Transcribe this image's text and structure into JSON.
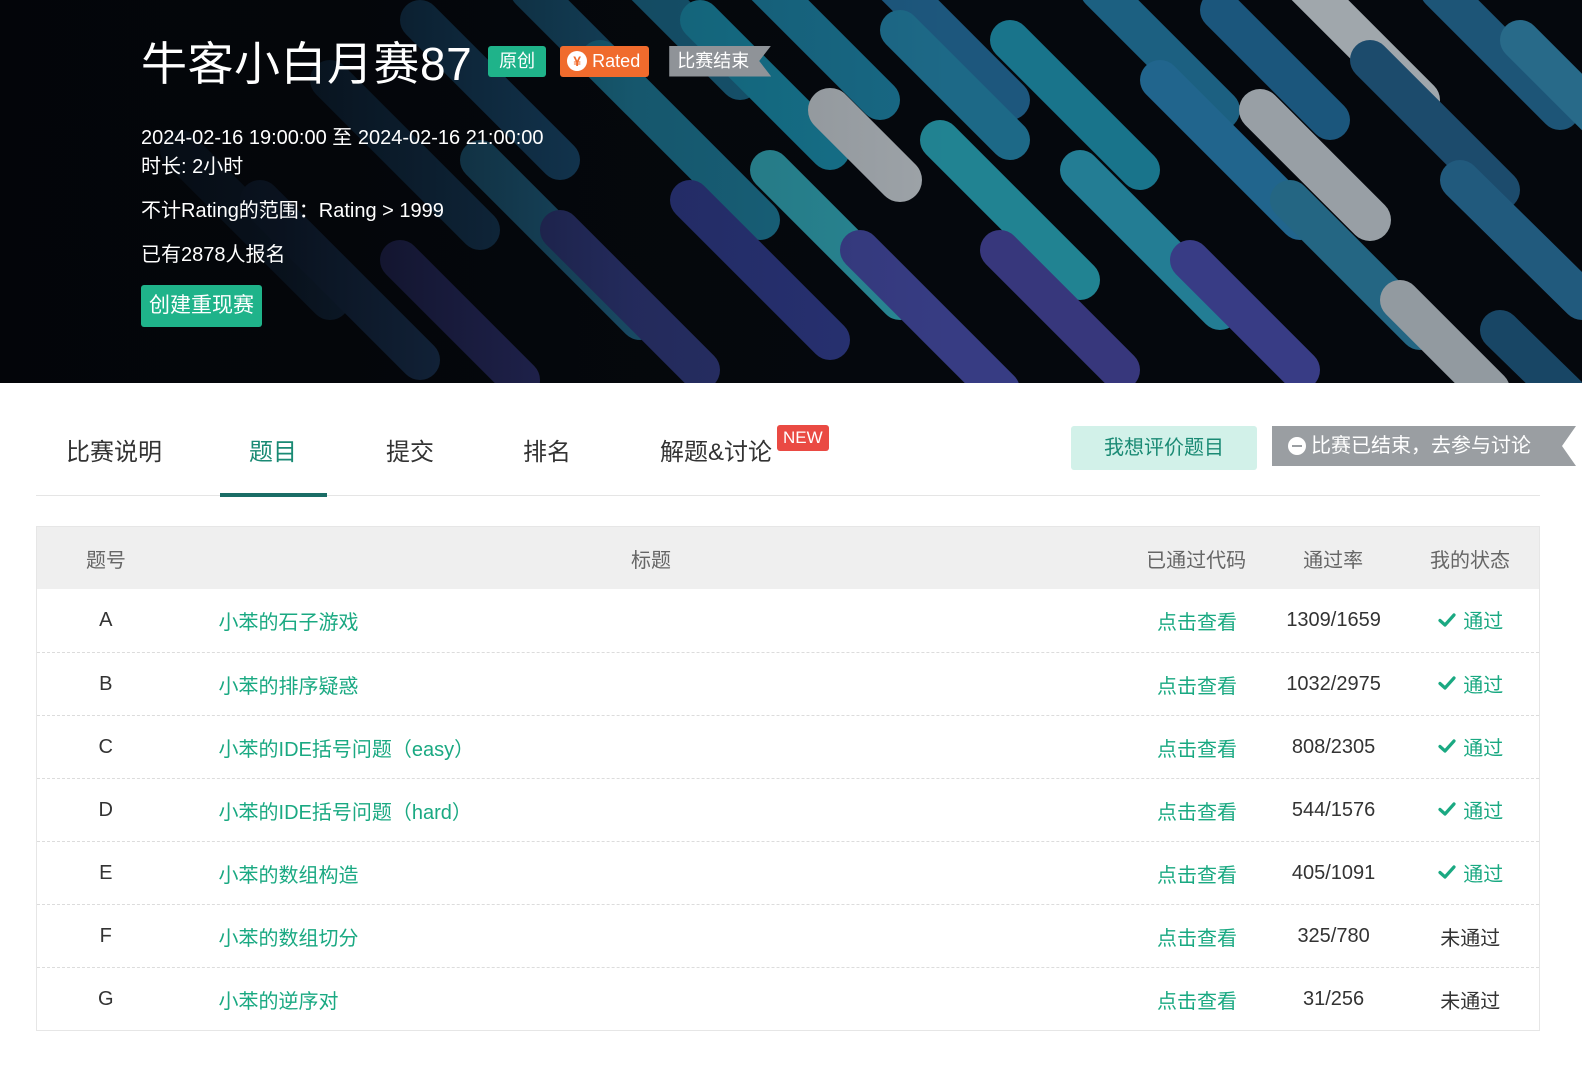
{
  "contest": {
    "title": "牛客小白月赛87",
    "tag_original": "原创",
    "tag_rated": "Rated",
    "tag_rated_icon": "yen-icon",
    "tag_ended": "比赛结束",
    "time_range": "2024-02-16 19:00:00 至 2024-02-16 21:00:00",
    "duration": "时长: 2小时",
    "rating_scope": "不计Rating的范围：Rating > 1999",
    "registered": "已有2878人报名",
    "create_replay_label": "创建重现赛"
  },
  "tabs": [
    {
      "label": "比赛说明",
      "active": false
    },
    {
      "label": "题目",
      "active": true
    },
    {
      "label": "提交",
      "active": false
    },
    {
      "label": "排名",
      "active": false
    },
    {
      "label": "解题&讨论",
      "active": false,
      "badge": "NEW"
    }
  ],
  "actions": {
    "review_label": "我想评价题目",
    "discuss_label": "比赛已结束，去参与讨论"
  },
  "table": {
    "headers": {
      "id": "题号",
      "title": "标题",
      "code": "已通过代码",
      "rate": "通过率",
      "status": "我的状态"
    },
    "rows": [
      {
        "id": "A",
        "title": "小苯的石子游戏",
        "code": "点击查看",
        "rate": "1309/1659",
        "status": "通过",
        "passed": true
      },
      {
        "id": "B",
        "title": "小苯的排序疑惑",
        "code": "点击查看",
        "rate": "1032/2975",
        "status": "通过",
        "passed": true
      },
      {
        "id": "C",
        "title": "小苯的IDE括号问题（easy）",
        "code": "点击查看",
        "rate": "808/2305",
        "status": "通过",
        "passed": true
      },
      {
        "id": "D",
        "title": "小苯的IDE括号问题（hard）",
        "code": "点击查看",
        "rate": "544/1576",
        "status": "通过",
        "passed": true
      },
      {
        "id": "E",
        "title": "小苯的数组构造",
        "code": "点击查看",
        "rate": "405/1091",
        "status": "通过",
        "passed": true
      },
      {
        "id": "F",
        "title": "小苯的数组切分",
        "code": "点击查看",
        "rate": "325/780",
        "status": "未通过",
        "passed": false
      },
      {
        "id": "G",
        "title": "小苯的逆序对",
        "code": "点击查看",
        "rate": "31/256",
        "status": "未通过",
        "passed": false
      }
    ]
  },
  "colors": {
    "brand_green": "#1fb38a",
    "link_green": "#1aa982",
    "rated_orange": "#f06b2d",
    "new_red": "#ea4a43",
    "ended_gray": "#8f9398"
  }
}
